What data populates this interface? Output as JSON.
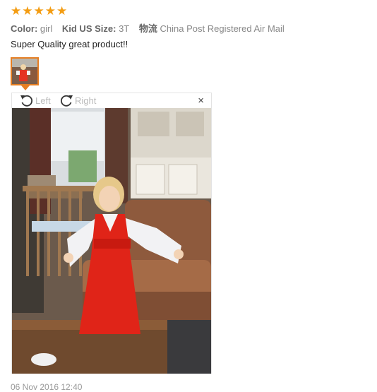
{
  "rating": {
    "stars": 5
  },
  "meta": {
    "color_label": "Color:",
    "color_value": "girl",
    "size_label": "Kid US Size:",
    "size_value": "3T",
    "shipping_label": "物流",
    "shipping_value": "China Post Registered Air Mail"
  },
  "review": {
    "text": "Super Quality great product!!"
  },
  "viewer": {
    "rotate_left": "Left",
    "rotate_right": "Right",
    "close": "×"
  },
  "footer": {
    "date": "06 Nov 2016 12:40"
  },
  "colors": {
    "star": "#f39c12",
    "thumb_border": "#e67e22"
  }
}
